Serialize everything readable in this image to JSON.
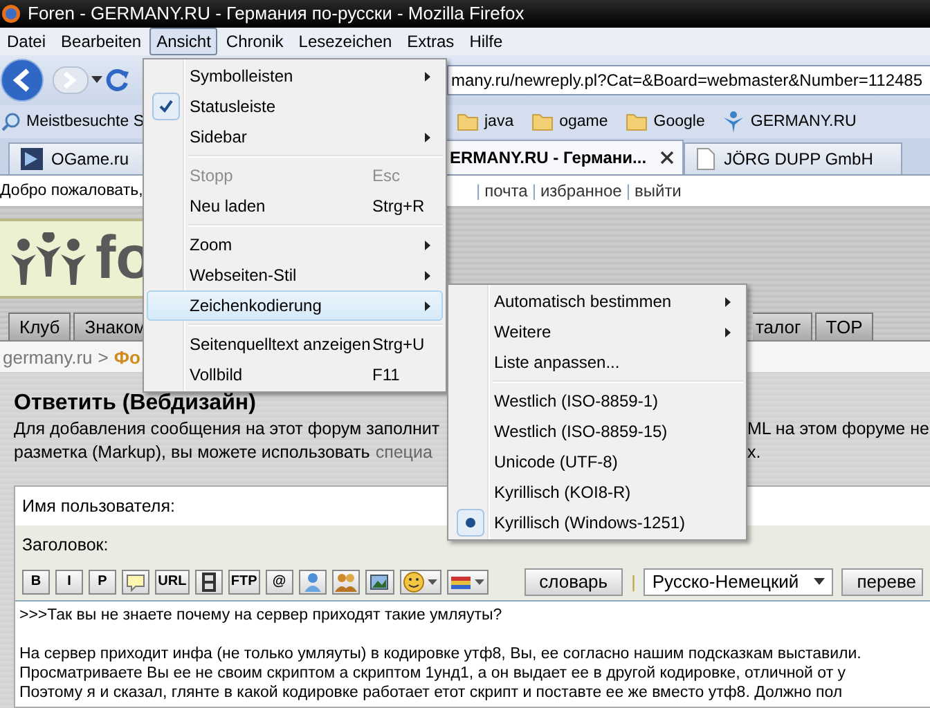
{
  "window": {
    "title": "Foren - GERMANY.RU - Германия по-русски - Mozilla Firefox"
  },
  "menu_bar": [
    {
      "label": "Datei",
      "selected": false
    },
    {
      "label": "Bearbeiten",
      "selected": false
    },
    {
      "label": "Ansicht",
      "selected": true
    },
    {
      "label": "Chronik",
      "selected": false
    },
    {
      "label": "Lesezeichen",
      "selected": false
    },
    {
      "label": "Extras",
      "selected": false
    },
    {
      "label": "Hilfe",
      "selected": false
    }
  ],
  "address_bar": {
    "value": "many.ru/newreply.pl?Cat=&Board=webmaster&Number=112485"
  },
  "bookmarks": [
    {
      "label": "Meistbesuchte S",
      "kind": "smart"
    },
    {
      "label": "java",
      "kind": "folder"
    },
    {
      "label": "ogame",
      "kind": "folder"
    },
    {
      "label": "Google",
      "kind": "folder"
    },
    {
      "label": "GERMANY.RU",
      "kind": "site"
    }
  ],
  "tabs": [
    {
      "label": "OGame.ru",
      "selected": false
    },
    {
      "label": "ERMANY.RU - Германи...",
      "selected": true
    },
    {
      "label": "JÖRG DUPP GmbH",
      "selected": false
    }
  ],
  "page": {
    "user_bar": {
      "greeting": "Добро пожаловать,",
      "separator": "|",
      "links": [
        "почта",
        "избранное",
        "выйти"
      ]
    },
    "logo_text": "fo",
    "nav_tabs_left": [
      "Клуб",
      "Знаком"
    ],
    "nav_tabs_right": [
      "талог",
      "TOP"
    ],
    "breadcrumb": {
      "separator": ">",
      "items": [
        "germany.ru",
        "Фо"
      ]
    },
    "heading": "Ответить (Вебдизайн)",
    "intro": [
      {
        "left": "Для добавления сообщения на этот форум заполнит",
        "right": "ML на этом форуме не"
      },
      {
        "left": "разметка (Markup), вы можете использовать",
        "link": "специа",
        "right": "х."
      }
    ],
    "form": {
      "username_label": "Имя пользователя:",
      "subject_label": "Заголовок:",
      "toolbar": [
        {
          "kind": "text",
          "label": "B"
        },
        {
          "kind": "text",
          "label": "I"
        },
        {
          "kind": "text",
          "label": "P"
        },
        {
          "kind": "comment"
        },
        {
          "kind": "text",
          "label": "URL"
        },
        {
          "kind": "film"
        },
        {
          "kind": "text",
          "label": "FTP"
        },
        {
          "kind": "text",
          "label": "@"
        },
        {
          "kind": "user"
        },
        {
          "kind": "group"
        },
        {
          "kind": "image"
        },
        {
          "kind": "smiley"
        },
        {
          "kind": "color"
        }
      ],
      "dictionary_button": "словарь",
      "separator": "|",
      "language": "Русско-Немецкий",
      "translate_button": "переве",
      "quote": ">>>Так вы не знаете почему на сервер приходят такие умляуты?",
      "lines": [
        "На сервер приходит инфа (не только умляуты) в кодировке утф8, Вы, ее согласно нашим подсказкам выставили.",
        "Просматриваете Вы ее не своим скриптом а скриптом 1унд1, а он выдает ее в другой кодировке, отличной от у",
        "Поэтому я и сказал, глянте в какой кодировке работает етот скрипт и поставте ее же вместо утф8. Должно пол"
      ]
    }
  },
  "view_menu": [
    {
      "kind": "item",
      "label": "Symbolleisten",
      "submenu": true,
      "checked": false,
      "disabled": false,
      "selected": false
    },
    {
      "kind": "item",
      "label": "Statusleiste",
      "submenu": false,
      "checked": true,
      "disabled": false,
      "selected": false
    },
    {
      "kind": "item",
      "label": "Sidebar",
      "submenu": true,
      "checked": false,
      "disabled": false,
      "selected": false
    },
    {
      "kind": "separator"
    },
    {
      "kind": "item",
      "label": "Stopp",
      "shortcut": "Esc",
      "submenu": false,
      "checked": false,
      "disabled": true,
      "selected": false
    },
    {
      "kind": "item",
      "label": "Neu laden",
      "shortcut": "Strg+R",
      "submenu": false,
      "checked": false,
      "disabled": false,
      "selected": false
    },
    {
      "kind": "separator"
    },
    {
      "kind": "item",
      "label": "Zoom",
      "submenu": true,
      "checked": false,
      "disabled": false,
      "selected": false
    },
    {
      "kind": "item",
      "label": "Webseiten-Stil",
      "submenu": true,
      "checked": false,
      "disabled": false,
      "selected": false
    },
    {
      "kind": "item",
      "label": "Zeichenkodierung",
      "submenu": true,
      "checked": false,
      "disabled": false,
      "selected": true
    },
    {
      "kind": "separator"
    },
    {
      "kind": "item",
      "label": "Seitenquelltext anzeigen",
      "shortcut": "Strg+U",
      "submenu": false,
      "checked": false,
      "disabled": false,
      "selected": false
    },
    {
      "kind": "item",
      "label": "Vollbild",
      "shortcut": "F11",
      "submenu": false,
      "checked": false,
      "disabled": false,
      "selected": false
    }
  ],
  "encoding_menu": [
    {
      "kind": "item",
      "label": "Automatisch bestimmen",
      "submenu": true,
      "checked": false
    },
    {
      "kind": "item",
      "label": "Weitere",
      "submenu": true,
      "checked": false
    },
    {
      "kind": "item",
      "label": "Liste anpassen...",
      "submenu": false,
      "checked": false
    },
    {
      "kind": "separator"
    },
    {
      "kind": "item",
      "label": "Westlich (ISO-8859-1)",
      "submenu": false,
      "checked": false
    },
    {
      "kind": "item",
      "label": "Westlich (ISO-8859-15)",
      "submenu": false,
      "checked": false
    },
    {
      "kind": "item",
      "label": "Unicode (UTF-8)",
      "submenu": false,
      "checked": false
    },
    {
      "kind": "item",
      "label": "Kyrillisch (KOI8-R)",
      "submenu": false,
      "checked": false
    },
    {
      "kind": "item",
      "label": "Kyrillisch (Windows-1251)",
      "submenu": false,
      "checked": true
    }
  ]
}
